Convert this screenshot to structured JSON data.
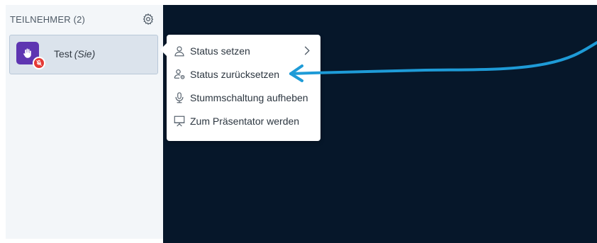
{
  "participants": {
    "title": "TEILNEHMER (2)",
    "settings_icon": "gear-icon",
    "users": [
      {
        "name": "Test",
        "you_label": "(Sie)",
        "avatar_icon": "raised-hand-icon",
        "badge_icon": "muted-microphone-icon"
      }
    ]
  },
  "context_menu": {
    "items": [
      {
        "label": "Status setzen",
        "icon": "user-icon",
        "has_submenu": true
      },
      {
        "label": "Status zurücksetzen",
        "icon": "user-reset-icon"
      },
      {
        "label": "Stummschaltung aufheben",
        "icon": "microphone-icon"
      },
      {
        "label": "Zum Präsentator werden",
        "icon": "presentation-icon"
      }
    ]
  },
  "colors": {
    "panel_bg": "#f3f6f9",
    "stage_bg": "#06172a",
    "avatar": "#5e35b1",
    "muted_badge": "#e53935",
    "annotation": "#1e9bd7"
  }
}
